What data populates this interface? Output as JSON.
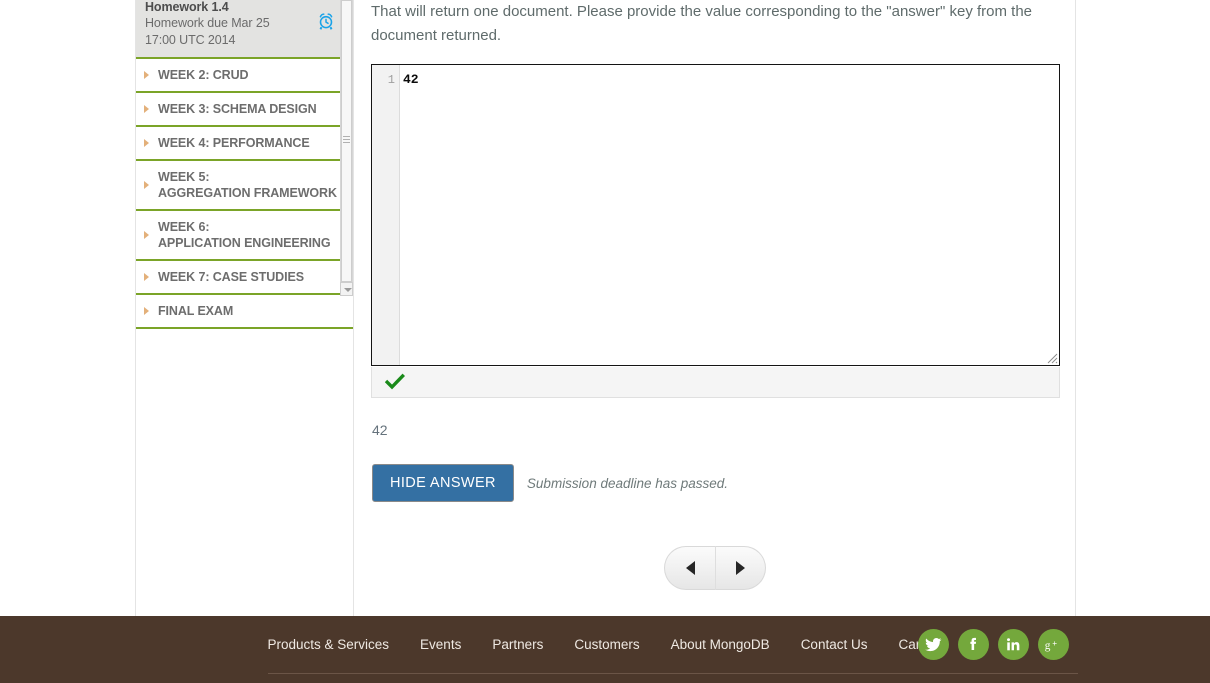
{
  "sidebar": {
    "current_homework": {
      "title": "Homework 1.4",
      "due_line1": "Homework due Mar 25",
      "due_line2": "17:00 UTC 2014",
      "icon": "alarm-clock-icon"
    },
    "items": [
      {
        "label": "WEEK 2: CRUD",
        "lines": [
          "WEEK 2: CRUD"
        ]
      },
      {
        "label": "WEEK 3: SCHEMA DESIGN",
        "lines": [
          "WEEK 3: SCHEMA DESIGN"
        ]
      },
      {
        "label": "WEEK 4: PERFORMANCE",
        "lines": [
          "WEEK 4: PERFORMANCE"
        ]
      },
      {
        "label": "WEEK 5: AGGREGATION FRAMEWORK",
        "lines": [
          "WEEK 5:",
          "AGGREGATION FRAMEWORK"
        ]
      },
      {
        "label": "WEEK 6: APPLICATION ENGINEERING",
        "lines": [
          "WEEK 6:",
          "APPLICATION ENGINEERING"
        ]
      },
      {
        "label": "WEEK 7: CASE STUDIES",
        "lines": [
          "WEEK 7: CASE STUDIES"
        ]
      },
      {
        "label": "FINAL EXAM",
        "lines": [
          "FINAL EXAM"
        ]
      }
    ],
    "scrollbar": {
      "down_arrow_icon": "chevron-down-icon"
    }
  },
  "main": {
    "question_text": "That will return one document. Please provide the value corresponding to the \"answer\" key from the document returned.",
    "editor": {
      "line_number": "1",
      "code": "42",
      "resize_handle_icon": "resize-grip-icon"
    },
    "status": {
      "icon": "green-check-icon",
      "correct": true
    },
    "answer_value": "42",
    "hide_answer_label": "HIDE ANSWER",
    "deadline_note": "Submission deadline has passed.",
    "nav": {
      "prev_icon": "triangle-left-icon",
      "next_icon": "triangle-right-icon"
    }
  },
  "footer": {
    "links": [
      "Products & Services",
      "Events",
      "Partners",
      "Customers",
      "About MongoDB",
      "Contact Us",
      "Careers"
    ],
    "social": [
      {
        "name": "twitter-icon",
        "glyph": "twitter"
      },
      {
        "name": "facebook-icon",
        "glyph": "facebook"
      },
      {
        "name": "linkedin-icon",
        "glyph": "linkedin"
      },
      {
        "name": "googleplus-icon",
        "glyph": "googleplus"
      }
    ]
  },
  "colors": {
    "footer_bg": "#4c382b",
    "social_green": "#74a83c",
    "week_border_green": "#7ba428",
    "button_blue": "#3470a3",
    "check_green": "#1a8a1a",
    "alarm_blue": "#1aa3e8",
    "triangle_tan": "#e3b07a"
  }
}
